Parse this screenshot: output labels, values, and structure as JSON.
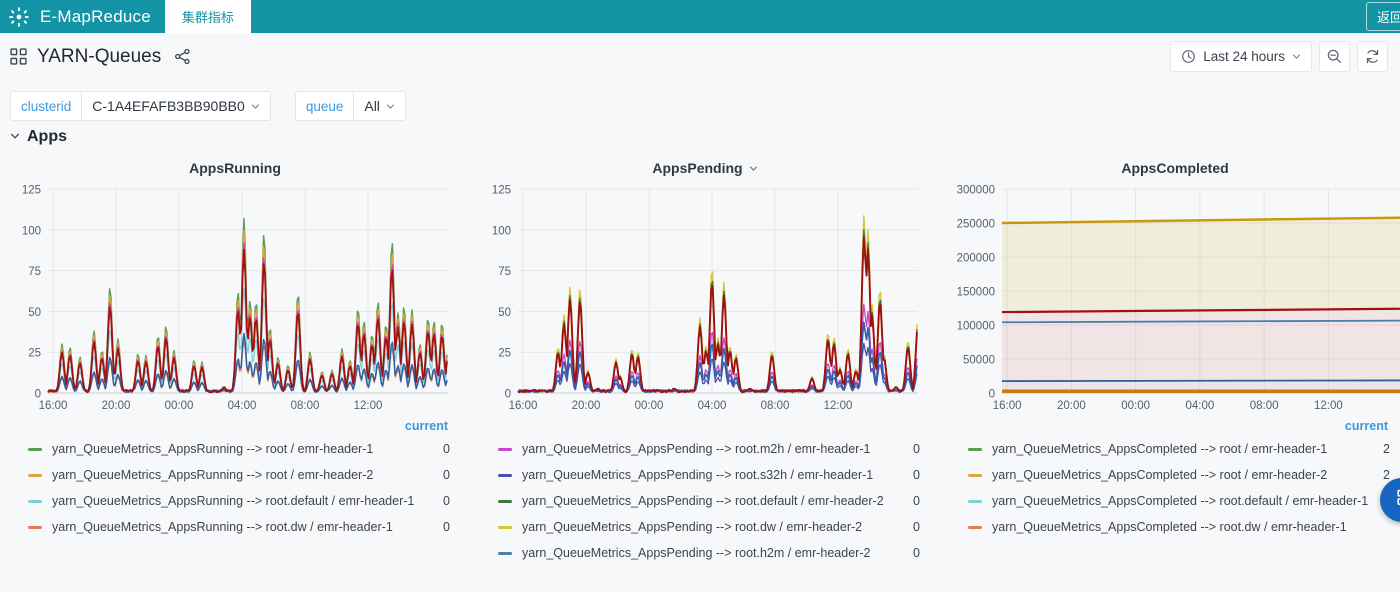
{
  "topbar": {
    "logo_icon": "emr-sunburst-icon",
    "brand": "E-MapReduce",
    "tab_label": "集群指标",
    "return_button": "返回",
    "bg_color": "#1394a5"
  },
  "dashboard_header": {
    "grid_icon": "dashboard-grid-icon",
    "title": "YARN-Queues",
    "share_icon": "share-icon",
    "time_picker": {
      "clock_icon": "clock-icon",
      "label": "Last 24 hours",
      "chevron_icon": "chevron-down-icon"
    },
    "zoom_out_button": "zoom-out-icon",
    "refresh_button": "refresh-icon"
  },
  "variables": [
    {
      "label": "clusterid",
      "value": "C-1A4EFAFB3BB90BB0",
      "chevron_icon": "chevron-down-icon"
    },
    {
      "label": "queue",
      "value": "All",
      "chevron_icon": "chevron-down-icon"
    }
  ],
  "row": {
    "chevron_icon": "chevron-down-icon",
    "title": "Apps"
  },
  "colors": {
    "accent_blue": "#3b9ae0",
    "brand_teal": "#1394a5",
    "fab_blue": "#1765c0",
    "green": "#569e4c",
    "orange": "#e0a33b",
    "cyan": "#7ecfd9",
    "salmon": "#ea7a54",
    "magenta": "#c746c7",
    "navy": "#4a4ea8",
    "darkgreen": "#3a7a3a",
    "yellow": "#d8c53a",
    "steel": "#4a7fa8",
    "darkred": "#a01010",
    "blue": "#2a62a8",
    "gold": "#c99a10"
  },
  "chart_data": [
    {
      "type": "line",
      "title": "AppsRunning",
      "xlabel": "",
      "ylabel": "",
      "ylim": [
        0,
        125
      ],
      "yticks": [
        0,
        25,
        50,
        75,
        100,
        125
      ],
      "xticks": [
        "16:00",
        "20:00",
        "00:00",
        "04:00",
        "08:00",
        "12:00"
      ],
      "grid": true,
      "legend_position": "bottom-table",
      "legend_columns": [
        "current"
      ],
      "series": [
        {
          "name": "yarn_QueueMetrics_AppsRunning --> root / emr-header-1",
          "color": "#569e4c",
          "current": "0"
        },
        {
          "name": "yarn_QueueMetrics_AppsRunning --> root / emr-header-2",
          "color": "#e0a33b",
          "current": "0"
        },
        {
          "name": "yarn_QueueMetrics_AppsRunning --> root.default / emr-header-1",
          "color": "#7ecfd9",
          "current": "0"
        },
        {
          "name": "yarn_QueueMetrics_AppsRunning --> root.dw / emr-header-1",
          "color": "#ea7a54",
          "current": "0"
        }
      ],
      "peaks": [
        {
          "x": 0.035,
          "y": 30
        },
        {
          "x": 0.055,
          "y": 28
        },
        {
          "x": 0.08,
          "y": 22
        },
        {
          "x": 0.115,
          "y": 38
        },
        {
          "x": 0.135,
          "y": 26
        },
        {
          "x": 0.155,
          "y": 65
        },
        {
          "x": 0.175,
          "y": 33
        },
        {
          "x": 0.225,
          "y": 24
        },
        {
          "x": 0.245,
          "y": 23
        },
        {
          "x": 0.275,
          "y": 35
        },
        {
          "x": 0.295,
          "y": 41
        },
        {
          "x": 0.315,
          "y": 26
        },
        {
          "x": 0.365,
          "y": 20
        },
        {
          "x": 0.385,
          "y": 19
        },
        {
          "x": 0.44,
          "y": 4
        },
        {
          "x": 0.475,
          "y": 62
        },
        {
          "x": 0.49,
          "y": 107
        },
        {
          "x": 0.505,
          "y": 57
        },
        {
          "x": 0.52,
          "y": 56
        },
        {
          "x": 0.54,
          "y": 98
        },
        {
          "x": 0.555,
          "y": 40
        },
        {
          "x": 0.575,
          "y": 22
        },
        {
          "x": 0.6,
          "y": 17
        },
        {
          "x": 0.625,
          "y": 61
        },
        {
          "x": 0.655,
          "y": 25
        },
        {
          "x": 0.685,
          "y": 13
        },
        {
          "x": 0.71,
          "y": 14
        },
        {
          "x": 0.735,
          "y": 27
        },
        {
          "x": 0.755,
          "y": 20
        },
        {
          "x": 0.775,
          "y": 52
        },
        {
          "x": 0.79,
          "y": 44
        },
        {
          "x": 0.81,
          "y": 36
        },
        {
          "x": 0.825,
          "y": 56
        },
        {
          "x": 0.845,
          "y": 42
        },
        {
          "x": 0.86,
          "y": 93
        },
        {
          "x": 0.875,
          "y": 49
        },
        {
          "x": 0.89,
          "y": 53
        },
        {
          "x": 0.91,
          "y": 51
        },
        {
          "x": 0.93,
          "y": 30
        },
        {
          "x": 0.95,
          "y": 46
        },
        {
          "x": 0.965,
          "y": 44
        },
        {
          "x": 0.985,
          "y": 43
        },
        {
          "x": 1.0,
          "y": 26
        }
      ]
    },
    {
      "type": "line",
      "title": "AppsPending",
      "title_menu_icon": "chevron-down-icon",
      "xlabel": "",
      "ylabel": "",
      "ylim": [
        0,
        125
      ],
      "yticks": [
        0,
        25,
        50,
        75,
        100,
        125
      ],
      "xticks": [
        "16:00",
        "20:00",
        "00:00",
        "04:00",
        "08:00",
        "12:00"
      ],
      "grid": true,
      "legend_position": "bottom-table",
      "legend_columns": [
        ""
      ],
      "series": [
        {
          "name": "yarn_QueueMetrics_AppsPending --> root.m2h / emr-header-1",
          "color": "#c746c7",
          "current": "0"
        },
        {
          "name": "yarn_QueueMetrics_AppsPending --> root.s32h / emr-header-1",
          "color": "#4a4ea8",
          "current": "0"
        },
        {
          "name": "yarn_QueueMetrics_AppsPending --> root.default / emr-header-2",
          "color": "#3a7a3a",
          "current": "0"
        },
        {
          "name": "yarn_QueueMetrics_AppsPending --> root.dw / emr-header-2",
          "color": "#d8c53a",
          "current": "0"
        },
        {
          "name": "yarn_QueueMetrics_AppsPending --> root.h2m / emr-header-2",
          "color": "#4a7fa8",
          "current": "0"
        }
      ],
      "peaks": [
        {
          "x": 0.04,
          "y": 2
        },
        {
          "x": 0.1,
          "y": 28
        },
        {
          "x": 0.115,
          "y": 48
        },
        {
          "x": 0.13,
          "y": 65
        },
        {
          "x": 0.155,
          "y": 64
        },
        {
          "x": 0.175,
          "y": 14
        },
        {
          "x": 0.2,
          "y": 3
        },
        {
          "x": 0.245,
          "y": 21
        },
        {
          "x": 0.255,
          "y": 11
        },
        {
          "x": 0.285,
          "y": 27
        },
        {
          "x": 0.3,
          "y": 25
        },
        {
          "x": 0.35,
          "y": 2
        },
        {
          "x": 0.39,
          "y": 3
        },
        {
          "x": 0.455,
          "y": 46
        },
        {
          "x": 0.47,
          "y": 29
        },
        {
          "x": 0.485,
          "y": 77
        },
        {
          "x": 0.5,
          "y": 34
        },
        {
          "x": 0.515,
          "y": 68
        },
        {
          "x": 0.53,
          "y": 29
        },
        {
          "x": 0.545,
          "y": 24
        },
        {
          "x": 0.58,
          "y": 3
        },
        {
          "x": 0.635,
          "y": 26
        },
        {
          "x": 0.7,
          "y": 2
        },
        {
          "x": 0.735,
          "y": 10
        },
        {
          "x": 0.775,
          "y": 37
        },
        {
          "x": 0.79,
          "y": 34
        },
        {
          "x": 0.805,
          "y": 16
        },
        {
          "x": 0.825,
          "y": 27
        },
        {
          "x": 0.845,
          "y": 15
        },
        {
          "x": 0.865,
          "y": 109
        },
        {
          "x": 0.875,
          "y": 100
        },
        {
          "x": 0.885,
          "y": 54
        },
        {
          "x": 0.905,
          "y": 64
        },
        {
          "x": 0.915,
          "y": 24
        },
        {
          "x": 0.945,
          "y": 4
        },
        {
          "x": 0.975,
          "y": 32
        },
        {
          "x": 1.0,
          "y": 47
        }
      ]
    },
    {
      "type": "area",
      "title": "AppsCompleted",
      "xlabel": "",
      "ylabel": "",
      "ylim": [
        0,
        300000
      ],
      "yticks": [
        0,
        50000,
        100000,
        150000,
        200000,
        250000,
        300000
      ],
      "xticks": [
        "16:00",
        "20:00",
        "00:00",
        "04:00",
        "08:00",
        "12:00"
      ],
      "grid": true,
      "legend_position": "bottom-table",
      "legend_columns": [
        "current"
      ],
      "series": [
        {
          "name": "yarn_QueueMetrics_AppsCompleted --> root / emr-header-1",
          "color": "#569e4c",
          "current": "2",
          "start": 250000,
          "end": 258000
        },
        {
          "name": "yarn_QueueMetrics_AppsCompleted --> root / emr-header-2",
          "color": "#e0a33b",
          "current": "2",
          "start": 119000,
          "end": 124000
        },
        {
          "name": "yarn_QueueMetrics_AppsCompleted --> root.default / emr-header-1",
          "color": "#7ecfd9",
          "current": "",
          "start": 104000,
          "end": 106500
        },
        {
          "name": "yarn_QueueMetrics_AppsCompleted --> root.dw / emr-header-1",
          "color": "#ea7a54",
          "current": "",
          "start": 17500,
          "end": 18500
        }
      ],
      "flat_lines": [
        {
          "value": 250000,
          "end_value": 258000,
          "color": "#c99a10",
          "width": 2.5,
          "fill": "rgba(205,200,90,0.18)"
        },
        {
          "value": 119000,
          "end_value": 124000,
          "color": "#a01010",
          "width": 2.2,
          "fill": "rgba(190,70,70,0.14)"
        },
        {
          "value": 104000,
          "end_value": 106500,
          "color": "#4a7fa8",
          "width": 1.8,
          "fill": "none"
        },
        {
          "value": 17500,
          "end_value": 18500,
          "color": "#2a62a8",
          "width": 1.8,
          "fill": "none"
        },
        {
          "value": 2500,
          "end_value": 2500,
          "color": "#c97a10",
          "width": 3.5,
          "fill": "none"
        }
      ]
    }
  ],
  "fab": {
    "icon": "panels-grid-icon"
  }
}
